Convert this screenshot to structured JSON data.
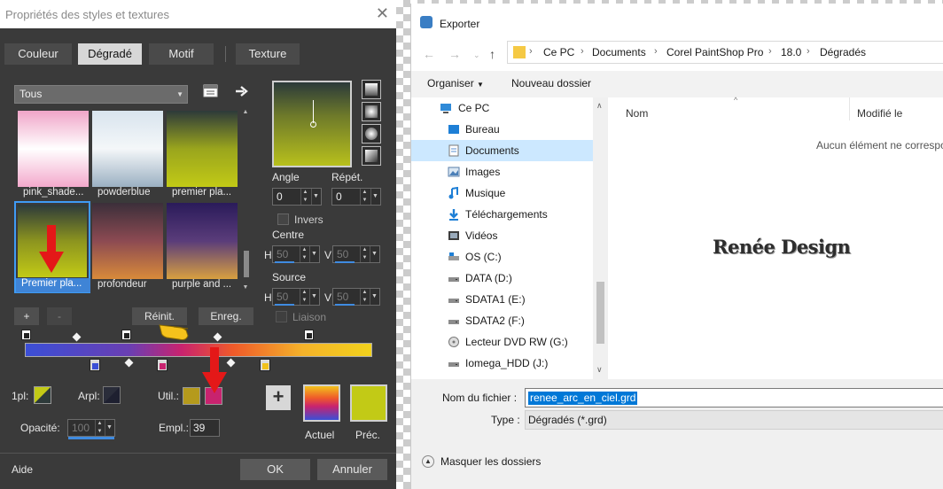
{
  "psp_dialog": {
    "title": "Propriétés des styles et textures",
    "tabs": [
      "Couleur",
      "Dégradé",
      "Motif",
      "Texture"
    ],
    "selected_tab": "Dégradé",
    "category": "Tous",
    "gradients": [
      {
        "label": "pink_shade...",
        "colors": [
          "#f0a5c8",
          "#ffffff",
          "#f3a9cc"
        ]
      },
      {
        "label": "powderblue",
        "colors": [
          "#d8e4ee",
          "#f4f7f9",
          "#9bb0c2"
        ]
      },
      {
        "label": "premier pla...",
        "colors": [
          "#2d3a3a",
          "#9aa51d",
          "#c2ca16"
        ]
      },
      {
        "label": "Premier pla...",
        "colors": [
          "#2d3a3a",
          "#8c941f",
          "#c2ca16"
        ]
      },
      {
        "label": "profondeur",
        "colors": [
          "#3b2f3a",
          "#8c4a52",
          "#d88a3a"
        ]
      },
      {
        "label": "purple and ...",
        "colors": [
          "#2a1b5a",
          "#5a3c7a",
          "#d8a040"
        ]
      }
    ],
    "selected_gradient_index": 3,
    "angle_label": "Angle",
    "angle_value": "0",
    "repeat_label": "Répét.",
    "repeat_value": "0",
    "invert_label": "Invers",
    "center_label": "Centre",
    "center_h_label": "H",
    "center_h": "50",
    "center_v_label": "V",
    "center_v": "50",
    "source_label": "Source",
    "source_h": "50",
    "source_v": "50",
    "link_label": "Liaison",
    "plus_label": "+",
    "minus_label": "-",
    "reset_label": "Réinit.",
    "save_label": "Enreg.",
    "first_plane_label": "1pl:",
    "bg_plane_label": "Arpl:",
    "user_label": "Util.:",
    "opacity_label": "Opacité:",
    "opacity_value": "100",
    "location_label": "Empl.:",
    "location_value": "39",
    "current_label": "Actuel",
    "previous_label": "Préc.",
    "help_label": "Aide",
    "ok_label": "OK",
    "cancel_label": "Annuler",
    "colors": {
      "user_swatch_1": "#b59a1c",
      "user_swatch_2": "#c8236f",
      "previous": "#c2ca16"
    }
  },
  "export_dialog": {
    "title": "Exporter",
    "breadcrumb": [
      "Ce PC",
      "Documents",
      "Corel PaintShop Pro",
      "18.0",
      "Dégradés"
    ],
    "organize_label": "Organiser",
    "new_folder_label": "Nouveau dossier",
    "tree": [
      {
        "label": "Ce PC",
        "icon": "computer-icon"
      },
      {
        "label": "Bureau",
        "icon": "desktop-icon"
      },
      {
        "label": "Documents",
        "icon": "documents-icon"
      },
      {
        "label": "Images",
        "icon": "images-icon"
      },
      {
        "label": "Musique",
        "icon": "music-icon"
      },
      {
        "label": "Téléchargements",
        "icon": "download-icon"
      },
      {
        "label": "Vidéos",
        "icon": "video-icon"
      },
      {
        "label": "OS (C:)",
        "icon": "drive-icon"
      },
      {
        "label": "DATA (D:)",
        "icon": "drive-icon"
      },
      {
        "label": "SDATA1 (E:)",
        "icon": "drive-icon"
      },
      {
        "label": "SDATA2 (F:)",
        "icon": "drive-icon"
      },
      {
        "label": "Lecteur DVD RW (G:)",
        "icon": "dvd-icon"
      },
      {
        "label": "Iomega_HDD (J:)",
        "icon": "drive-icon"
      }
    ],
    "selected_tree_index": 2,
    "col_name": "Nom",
    "col_modified": "Modifié le",
    "empty_text": "Aucun élément ne correspo",
    "watermark": "Renée Design",
    "filename_label": "Nom du fichier :",
    "filename_value": "renee_arc_en_ciel.grd",
    "type_label": "Type :",
    "type_value": "Dégradés (*.grd)",
    "hide_folders_label": "Masquer les dossiers"
  }
}
